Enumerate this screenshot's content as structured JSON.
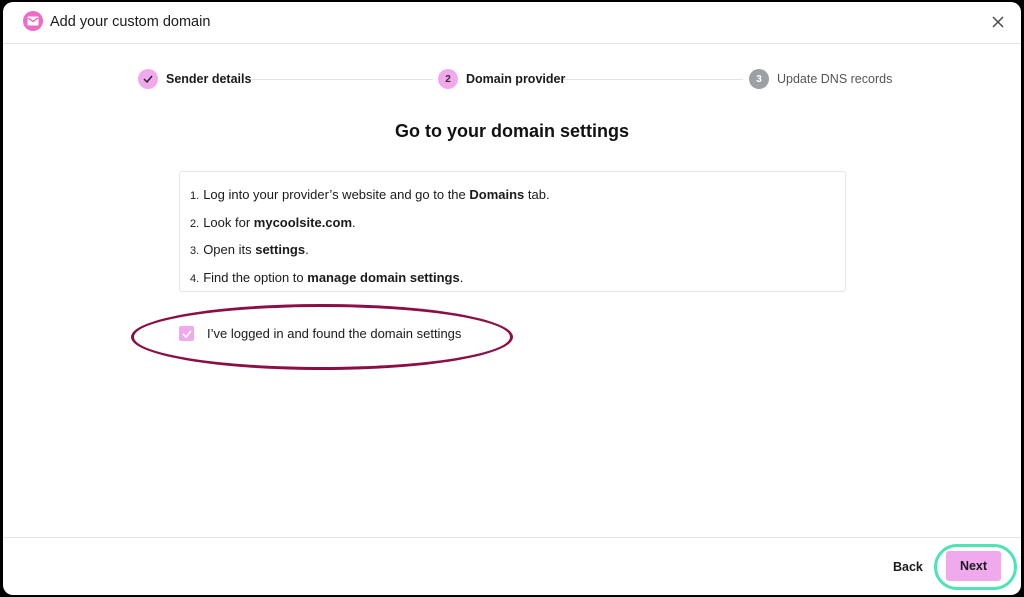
{
  "dialog": {
    "title": "Add your custom domain",
    "brand_color": "#ee6cc8"
  },
  "stepper": {
    "steps": [
      {
        "number": "1",
        "label": "Sender details",
        "state": "done"
      },
      {
        "number": "2",
        "label": "Domain provider",
        "state": "active"
      },
      {
        "number": "3",
        "label": "Update DNS records",
        "state": "pending"
      }
    ]
  },
  "main": {
    "heading": "Go to your domain settings",
    "instructions": [
      {
        "num": "1.",
        "pre": "Log into your provider’s website and go to the ",
        "bold": "Domains",
        "post": " tab."
      },
      {
        "num": "2.",
        "pre": "Look for ",
        "bold": "mycoolsite.com",
        "post": "."
      },
      {
        "num": "3.",
        "pre": "Open its ",
        "bold": "settings",
        "post": "."
      },
      {
        "num": "4.",
        "pre": "Find the option to ",
        "bold": "manage domain settings",
        "post": "."
      }
    ],
    "confirm_label": "I’ve logged in and found the domain settings",
    "confirm_checked": true
  },
  "footer": {
    "back_label": "Back",
    "next_label": "Next"
  },
  "colors": {
    "accent": "#f1a9ee",
    "highlight_red": "#8a0f46",
    "highlight_teal": "#4fe3b8"
  },
  "icons": {
    "logo": "envelope-icon",
    "close": "close-icon",
    "check": "check-icon"
  }
}
